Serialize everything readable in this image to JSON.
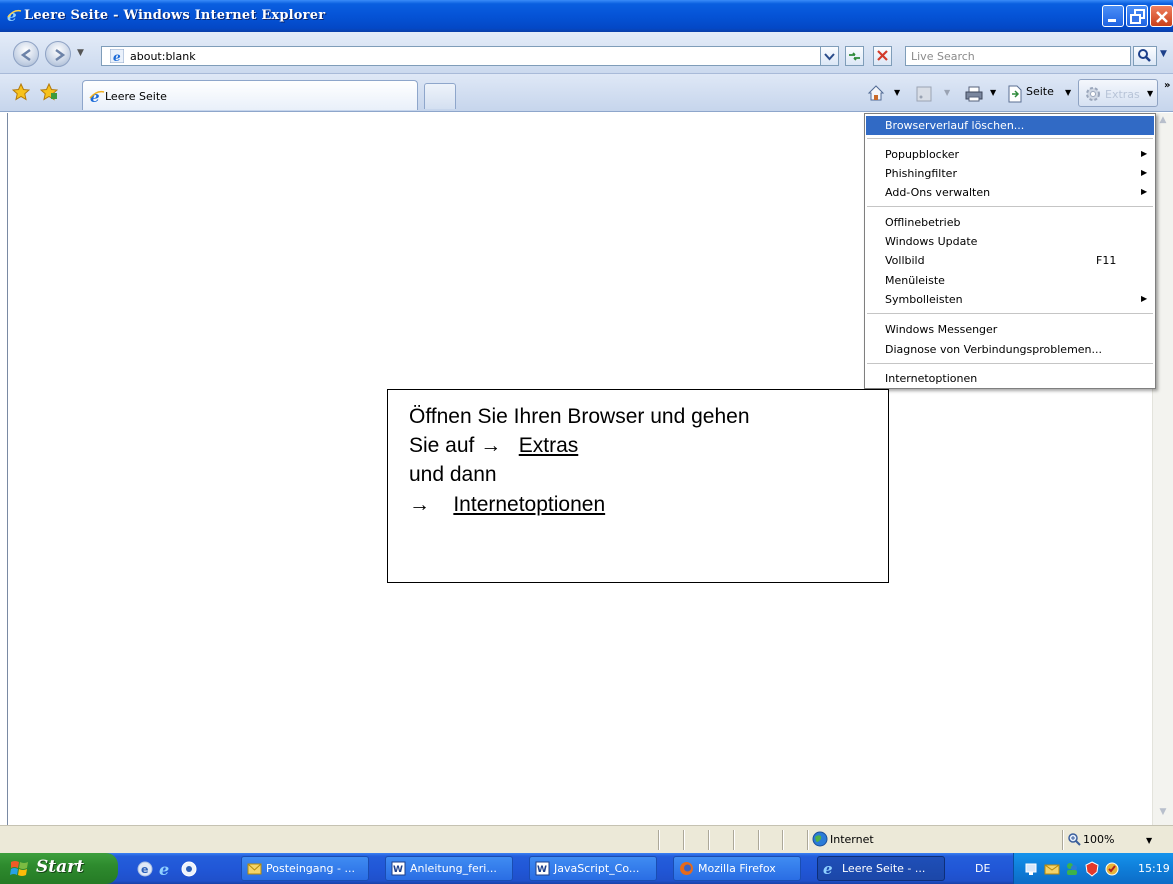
{
  "window": {
    "title": "Leere Seite - Windows Internet Explorer"
  },
  "address_bar": {
    "url": "about:blank",
    "search_placeholder": "Live Search"
  },
  "tabs": [
    {
      "label": "Leere Seite",
      "active": true
    }
  ],
  "command_bar": {
    "page_label": "Seite",
    "extras_label": "Extras"
  },
  "extras_menu": {
    "items": [
      {
        "label": "Browserverlauf löschen...",
        "highlighted": true
      },
      {
        "label": "Popupblocker",
        "submenu": true
      },
      {
        "label": "Phishingfilter",
        "submenu": true
      },
      {
        "label": "Add-Ons verwalten",
        "submenu": true
      },
      {
        "label": "Offlinebetrieb"
      },
      {
        "label": "Windows Update"
      },
      {
        "label": "Vollbild",
        "shortcut": "F11"
      },
      {
        "label": "Menüleiste"
      },
      {
        "label": "Symbolleisten",
        "submenu": true
      },
      {
        "label": "Windows Messenger"
      },
      {
        "label": "Diagnose von Verbindungsproblemen..."
      },
      {
        "label": "Internetoptionen"
      }
    ]
  },
  "callout": {
    "line1": "Öffnen Sie  Ihren Browser und gehen",
    "line2_prefix": "Sie auf →",
    "line2_link": "Extras",
    "line3": "und dann",
    "line4_prefix": "→",
    "line4_link": "Internetoptionen"
  },
  "status_bar": {
    "zone": "Internet",
    "zoom": "100%"
  },
  "taskbar": {
    "start_label": "Start",
    "tasks": [
      {
        "label": "Posteingang - ...",
        "icon": "outlook-icon"
      },
      {
        "label": "Anleitung_feri...",
        "icon": "word-icon"
      },
      {
        "label": "JavaScript_Co...",
        "icon": "word-icon"
      },
      {
        "label": "Mozilla Firefox",
        "icon": "firefox-icon"
      },
      {
        "label": "Leere Seite - ...",
        "icon": "ie-icon",
        "active": true
      }
    ],
    "language": "DE",
    "clock": "15:19"
  },
  "colors": {
    "titlebar_blue": "#0553d6",
    "menu_highlight": "#316ac5",
    "taskbar_blue": "#245edb",
    "start_green": "#2e8b2e"
  }
}
